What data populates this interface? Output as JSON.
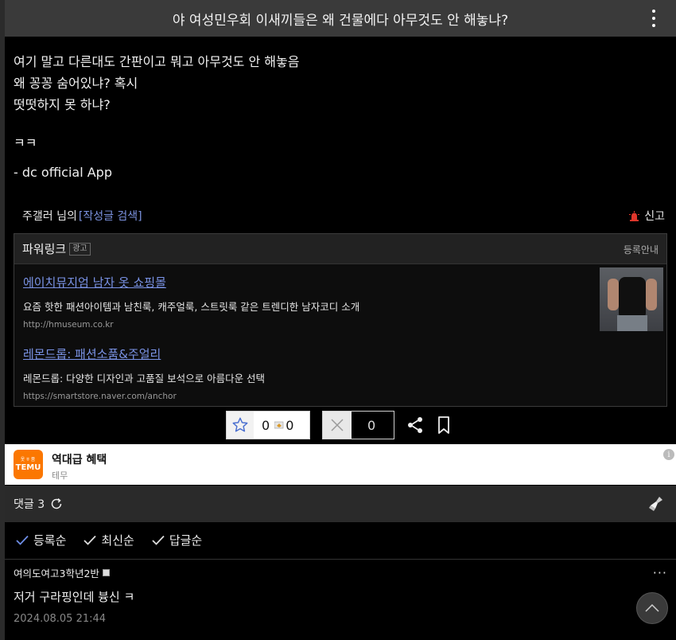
{
  "post": {
    "title": "야 여성민우회 이새끼들은 왜 건물에다 아무것도 안 해놓냐?",
    "body_lines": [
      "여기 말고 다른대도 간판이고 뭐고 아무것도 안 해놓음",
      "왜 꽁꽁 숨어있냐? 혹시",
      "떳떳하지 못 하냐?",
      "ㅋㅋ",
      "- dc official App"
    ]
  },
  "author": {
    "name": "주갤러 님의",
    "search_link": "[작성글 검색]",
    "report_label": "신고"
  },
  "powerlink": {
    "title": "파워링크",
    "ad_badge": "광고",
    "guide_label": "등록안내",
    "ads": [
      {
        "title": "에이치뮤지엄 남자 옷 쇼핑몰",
        "description": "요즘 핫한 패션아이템과 남친룩, 캐주얼룩, 스트릿룩 같은 트렌디한 남자코디 소개",
        "url": "http://hmuseum.co.kr"
      },
      {
        "title": "레몬드롭: 패션소품&주얼리",
        "description": "레몬드롭: 다양한 디자인과 고품질 보석으로 아름다운 선택",
        "url": "https://smartstore.naver.com/anchor"
      }
    ]
  },
  "reactions": {
    "recommend_count": "0",
    "fixed_recommend_count": "0",
    "not_recommend_count": "0"
  },
  "promo": {
    "logo_small": "옷ㅎ품",
    "logo_word": "TEMU",
    "title": "역대급 혜택",
    "subtitle": "테무",
    "info_symbol": "i"
  },
  "comments": {
    "label": "댓글 3",
    "sort_options": [
      "등록순",
      "최신순",
      "답글순"
    ],
    "items": [
      {
        "author": "여의도여고3학년2반",
        "text": "저거 구라핑인데 븅신 ㅋ",
        "date": "2024.08.05 21:44",
        "more": "···"
      }
    ]
  },
  "colors": {
    "link": "#7a93e6",
    "temu": "#fb7701",
    "report": "#e0362b"
  }
}
